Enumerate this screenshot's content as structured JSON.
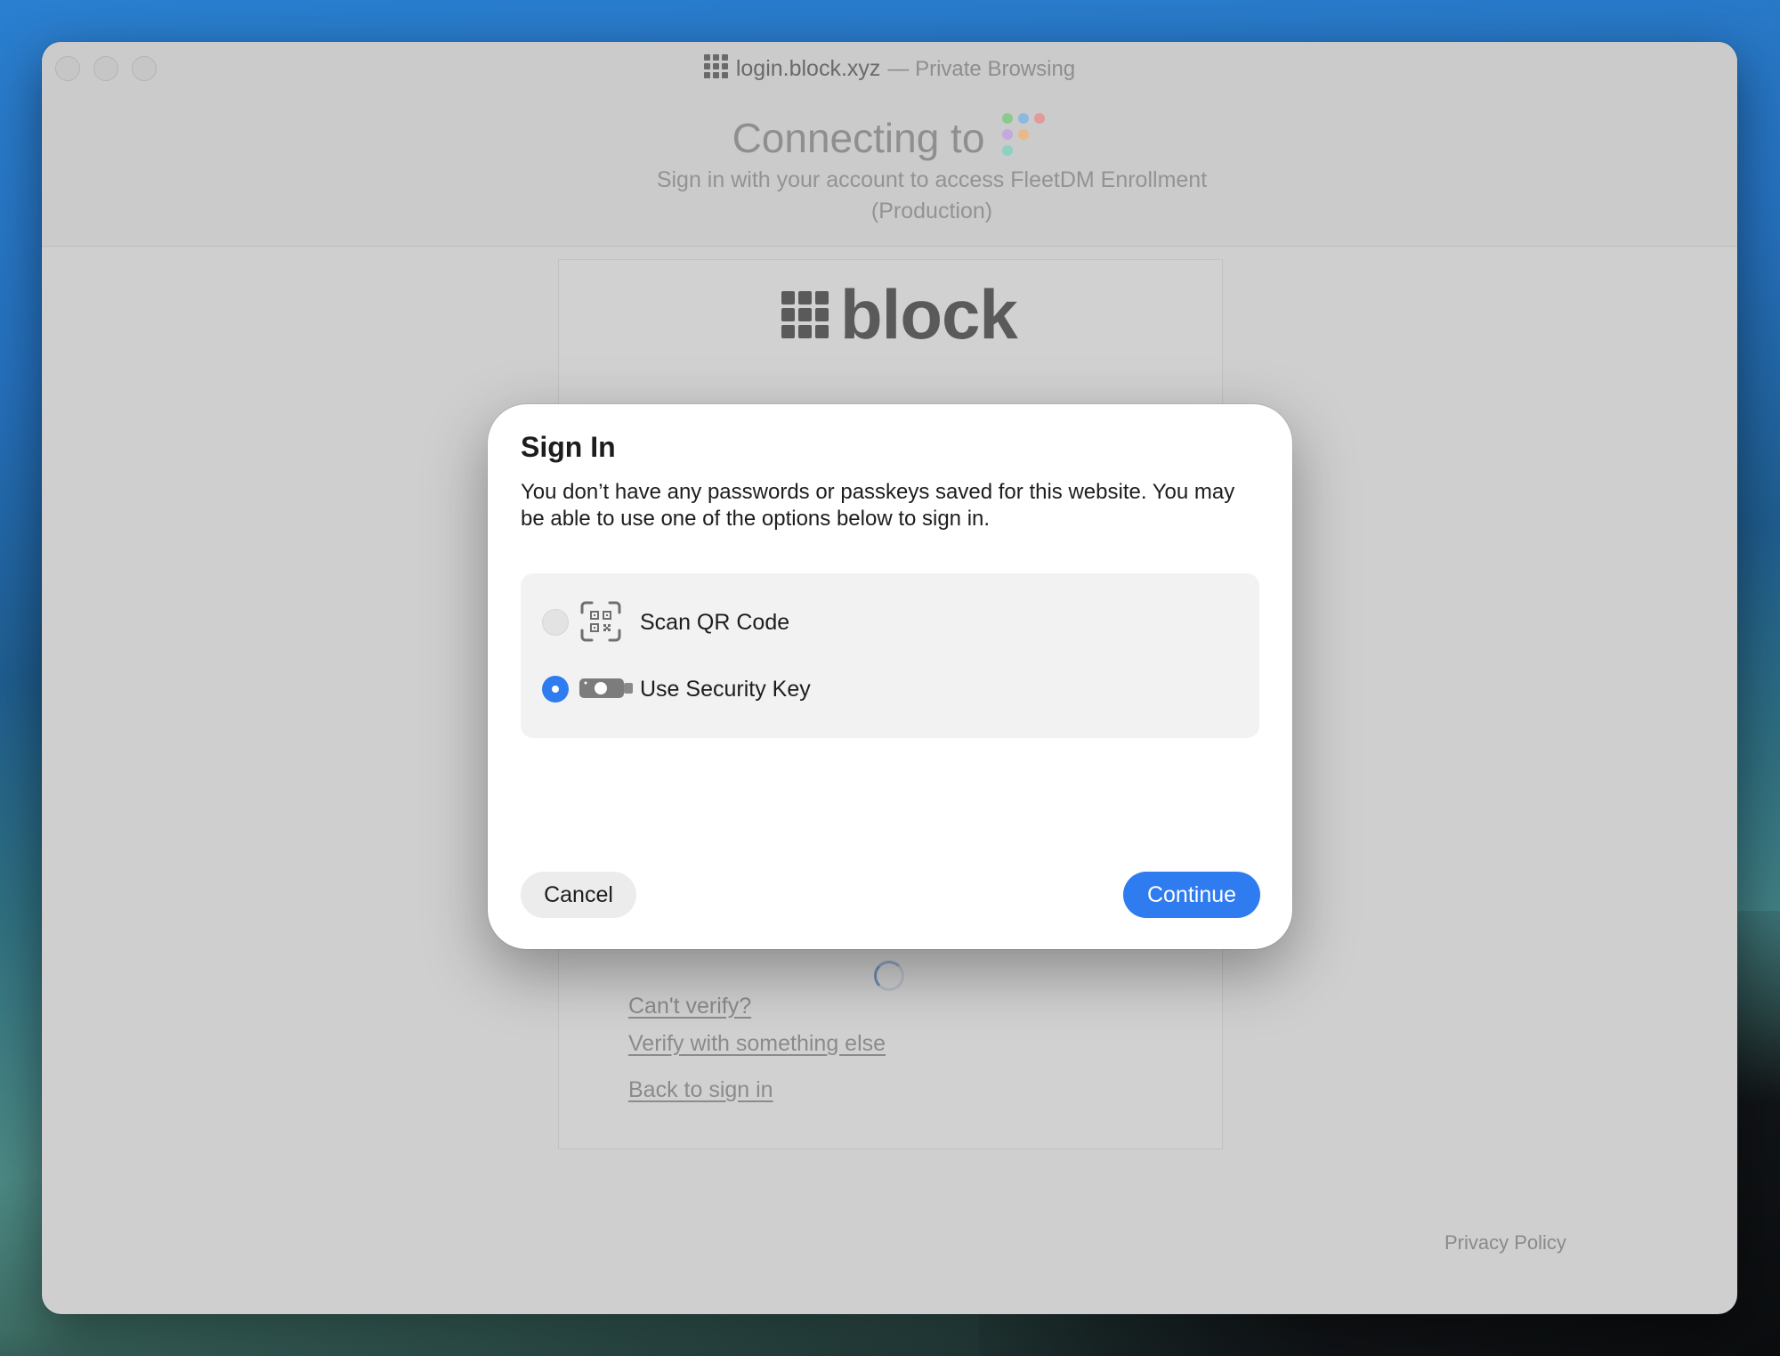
{
  "window": {
    "domain": "login.block.xyz",
    "mode": "— Private Browsing"
  },
  "header": {
    "connecting": "Connecting to",
    "subtitle": "Sign in with your account to access FleetDM Enrollment (Production)"
  },
  "card": {
    "logo_text": "block",
    "links": [
      "Can't verify?",
      "Verify with something else",
      "Back to sign in"
    ]
  },
  "footer": {
    "privacy": "Privacy Policy"
  },
  "dialog": {
    "title": "Sign In",
    "message": "You don’t have any passwords or passkeys saved for this website. You may be able to use one of the options below to sign in.",
    "options": [
      {
        "label": "Scan QR Code",
        "icon": "qr-code-icon",
        "selected": false
      },
      {
        "label": "Use Security Key",
        "icon": "security-key-icon",
        "selected": true
      }
    ],
    "cancel_label": "Cancel",
    "continue_label": "Continue"
  },
  "colors": {
    "accent": "#2f7bf0",
    "dots": [
      "#8cc98e",
      "#8fb8e0",
      "#e29a9a",
      "#c5a8e0",
      "#e8b98a",
      "#8fd0c0"
    ]
  }
}
